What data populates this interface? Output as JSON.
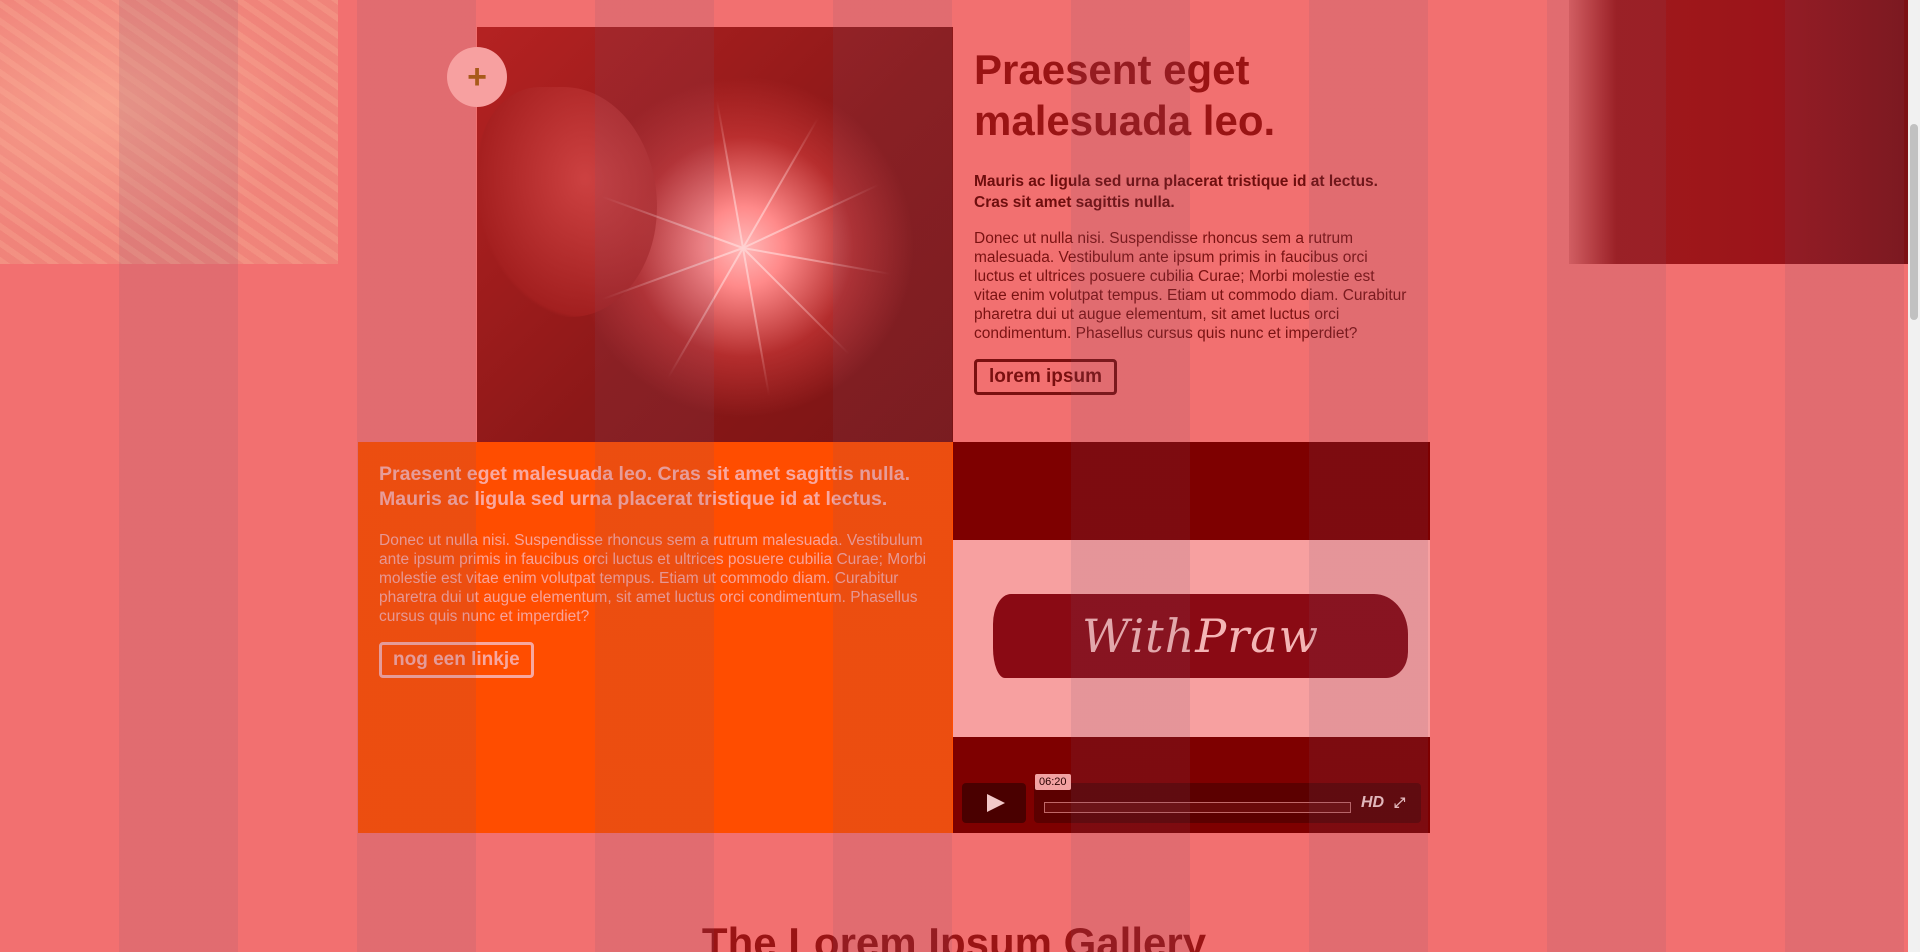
{
  "hero": {
    "plus_label": "+",
    "title": "Praesent eget malesuada leo.",
    "lead": "Mauris ac ligula sed urna placerat tristique id at lectus. Cras sit amet sagittis nulla.",
    "body": "Donec ut nulla nisi. Suspendisse rhoncus sem a rutrum malesuada. Vestibulum ante ipsum primis in faucibus orci luctus et ultrices posuere cubilia Curae; Morbi molestie est vitae enim volutpat tempus. Etiam ut commodo diam. Curabitur pharetra dui ut augue elementum, sit amet luctus orci condimentum. Phasellus cursus quis nunc et imperdiet?",
    "button_label": "lorem ipsum"
  },
  "feature": {
    "title": "Praesent eget malesuada leo. Cras sit amet sagittis nulla. Mauris ac ligula sed urna placerat tristique id at lectus.",
    "body": "Donec ut nulla nisi. Suspendisse rhoncus sem a rutrum malesuada. Vestibulum ante ipsum primis in faucibus orci luctus et ultrices posuere cubilia Curae; Morbi molestie est vitae enim volutpat tempus. Etiam ut commodo diam. Curabitur pharetra dui ut augue elementum, sit amet luctus orci condimentum. Phasellus cursus quis nunc et imperdiet?",
    "button_label": "nog een linkje"
  },
  "video": {
    "logo_text": "WithPraw",
    "duration": "06:20",
    "hd_label": "HD",
    "progress": 0,
    "play_icon": "play-icon",
    "fullscreen_icon": "fullscreen-icon"
  },
  "gallery": {
    "title": "The Lorem Ipsum Gallery"
  },
  "colors": {
    "page_bg": "#f27070",
    "orange_block": "#ff4d00",
    "video_bg": "#7e0000",
    "heading": "#9a1414"
  }
}
